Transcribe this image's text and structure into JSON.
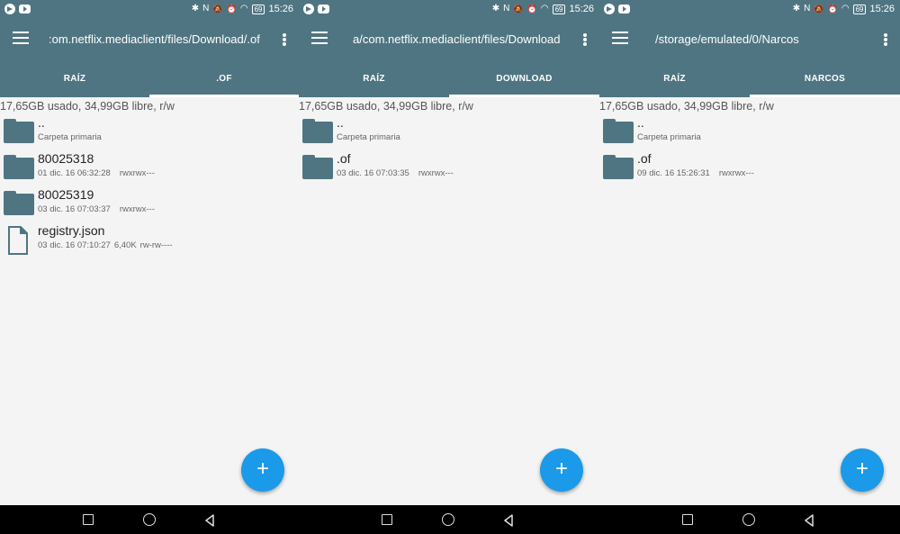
{
  "status": {
    "time": "15:26",
    "battery": "69"
  },
  "screens": [
    {
      "title": ":om.netflix.mediaclient/files/Download/.of",
      "tabs": [
        {
          "label": "RAÍZ",
          "active": false
        },
        {
          "label": ".OF",
          "active": true
        }
      ],
      "storage": "17,65GB usado, 34,99GB libre, r/w",
      "items": [
        {
          "type": "folder",
          "name": "..",
          "meta": "Carpeta primaria",
          "perm": ""
        },
        {
          "type": "folder",
          "name": "80025318",
          "meta": "01 dic. 16 06:32:28",
          "perm": "rwxrwx---"
        },
        {
          "type": "folder",
          "name": "80025319",
          "meta": "03 dic. 16 07:03:37",
          "perm": "rwxrwx---"
        },
        {
          "type": "file",
          "name": "registry.json",
          "meta": "03 dic. 16 07:10:27",
          "size": "6,40K",
          "perm": "rw-rw----"
        }
      ],
      "fab": "+"
    },
    {
      "title": "a/com.netflix.mediaclient/files/Download",
      "tabs": [
        {
          "label": "RAÍZ",
          "active": false
        },
        {
          "label": "DOWNLOAD",
          "active": true
        }
      ],
      "storage": "17,65GB usado, 34,99GB libre, r/w",
      "items": [
        {
          "type": "folder",
          "name": "..",
          "meta": "Carpeta primaria",
          "perm": ""
        },
        {
          "type": "folder",
          "name": ".of",
          "meta": "03 dic. 16 07:03:35",
          "perm": "rwxrwx---"
        }
      ],
      "fab": "+"
    },
    {
      "title": "/storage/emulated/0/Narcos",
      "tabs": [
        {
          "label": "RAÍZ",
          "active": false
        },
        {
          "label": "NARCOS",
          "active": true
        }
      ],
      "storage": "17,65GB usado, 34,99GB libre, r/w",
      "items": [
        {
          "type": "folder",
          "name": "..",
          "meta": "Carpeta primaria",
          "perm": ""
        },
        {
          "type": "folder",
          "name": ".of",
          "meta": "09 dic. 16 15:26:31",
          "perm": "rwxrwx---"
        }
      ],
      "fab": "+"
    }
  ],
  "colors": {
    "toolbar": "#4f7582",
    "fab": "#1a9ae8",
    "background": "#f4f4f4"
  },
  "icons": {
    "menu": "hamburger-icon",
    "more": "more-vert-icon",
    "folder": "folder-icon",
    "file": "file-icon",
    "fab": "plus-icon",
    "nav": [
      "recents-icon",
      "home-icon",
      "back-icon"
    ]
  }
}
